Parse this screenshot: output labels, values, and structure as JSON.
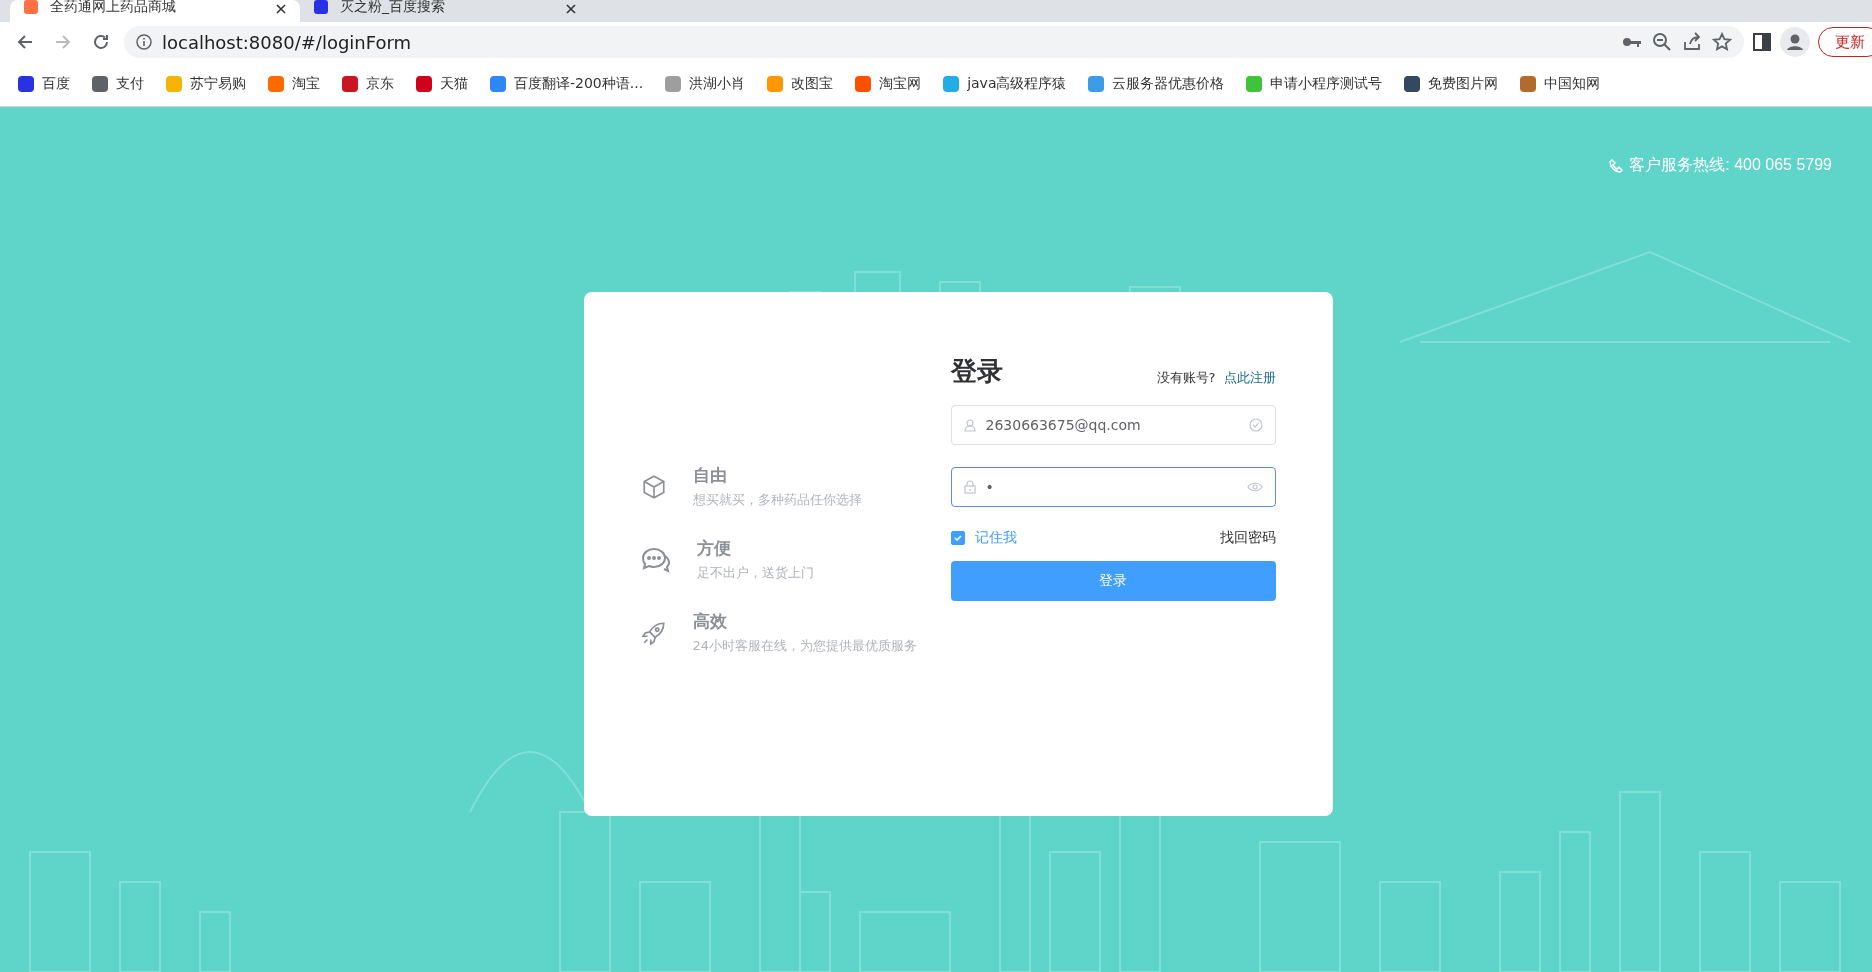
{
  "browser": {
    "tabs": [
      {
        "title": "全药通网上药品商城",
        "selected": true
      },
      {
        "title": "灭之粉_百度搜索",
        "selected": false
      }
    ],
    "address": "localhost:8080/#/loginForm",
    "update_button": "更新",
    "bookmarks": [
      {
        "label": "百度",
        "color": "#2932e1"
      },
      {
        "label": "支付",
        "color": "#5f6368"
      },
      {
        "label": "苏宁易购",
        "color": "#f5b400"
      },
      {
        "label": "淘宝",
        "color": "#ff6a00"
      },
      {
        "label": "京东",
        "color": "#c91623"
      },
      {
        "label": "天猫",
        "color": "#d0021b"
      },
      {
        "label": "百度翻译-200种语...",
        "color": "#2f86f6"
      },
      {
        "label": "洪湖小肖",
        "color": "#9e9e9e"
      },
      {
        "label": "改图宝",
        "color": "#ff9800"
      },
      {
        "label": "淘宝网",
        "color": "#ff5000"
      },
      {
        "label": "java高级程序猿",
        "color": "#23ade5"
      },
      {
        "label": "云服务器优惠价格",
        "color": "#3b9ce8"
      },
      {
        "label": "申请小程序测试号",
        "color": "#3ec33a"
      },
      {
        "label": "免费图片网",
        "color": "#34495e"
      },
      {
        "label": "中国知网",
        "color": "#b36b2c"
      }
    ]
  },
  "hotline": "客户服务热线: 400 065 5799",
  "features": [
    {
      "kind": "box",
      "title": "自由",
      "subtitle": "想买就买，多种药品任你选择"
    },
    {
      "kind": "chat",
      "title": "方便",
      "subtitle": "足不出户，送货上门"
    },
    {
      "kind": "rocket",
      "title": "高效",
      "subtitle": "24小时客服在线，为您提供最优质服务"
    }
  ],
  "login": {
    "title": "登录",
    "no_account": "没有账号?",
    "register_link": "点此注册",
    "username": {
      "value": "2630663675@qq.com"
    },
    "password": {
      "value": "•"
    },
    "remember": {
      "label": "记住我",
      "checked": true
    },
    "forgot": "找回密码",
    "submit": "登录"
  }
}
